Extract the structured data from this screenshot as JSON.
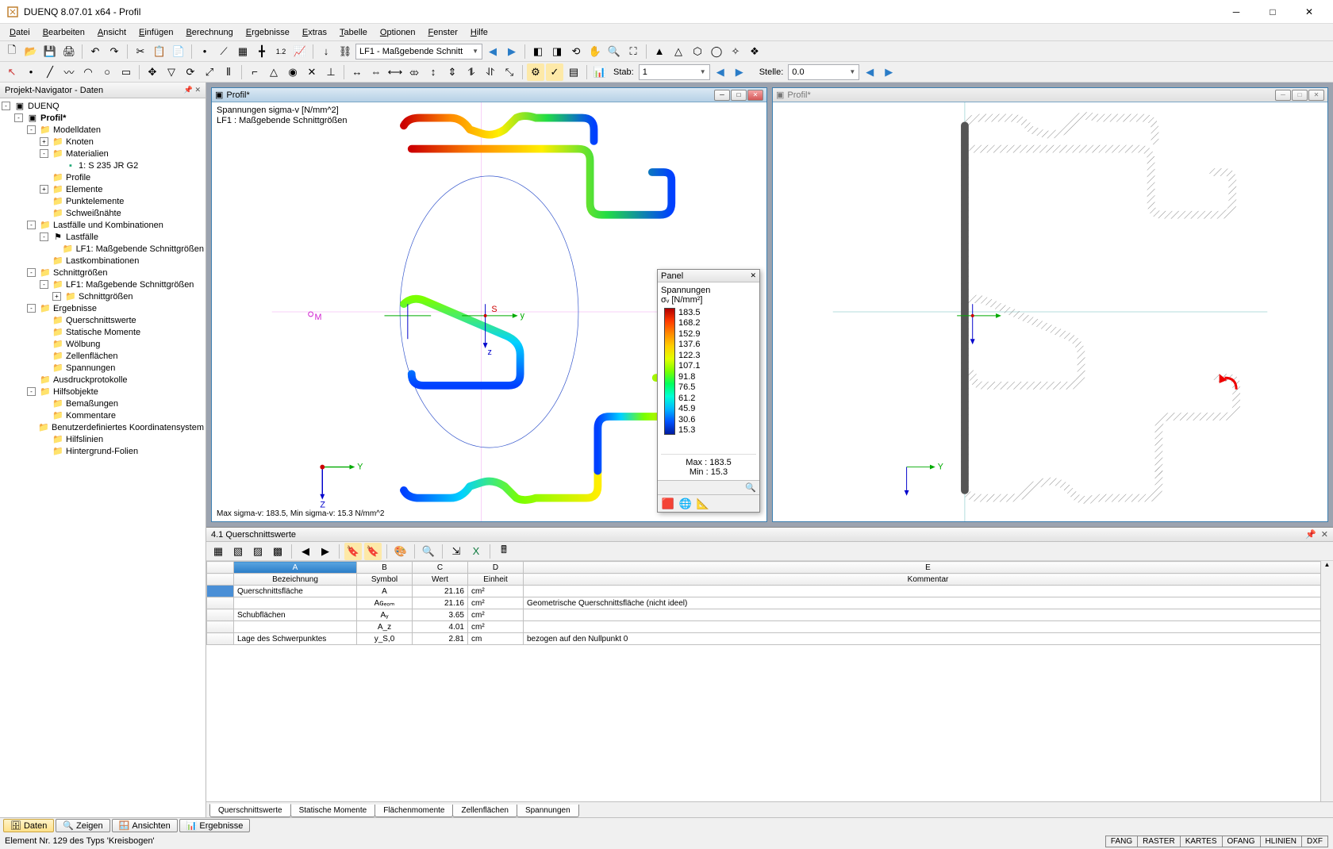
{
  "titlebar": {
    "text": "DUENQ 8.07.01 x64 - Profil"
  },
  "menus": [
    "Datei",
    "Bearbeiten",
    "Ansicht",
    "Einfügen",
    "Berechnung",
    "Ergebnisse",
    "Extras",
    "Tabelle",
    "Optionen",
    "Fenster",
    "Hilfe"
  ],
  "toolbar1": {
    "combo_lf": "LF1 - Maßgebende Schnitt"
  },
  "toolbar2": {
    "stab_label": "Stab:",
    "stab_value": "1",
    "stelle_label": "Stelle:",
    "stelle_value": "0.0"
  },
  "navigator": {
    "title": "Projekt-Navigator - Daten",
    "root": "DUENQ",
    "items": [
      {
        "d": 0,
        "t": "-",
        "i": "app",
        "l": "DUENQ",
        "b": false
      },
      {
        "d": 1,
        "t": "-",
        "i": "app",
        "l": "Profil*",
        "b": true
      },
      {
        "d": 2,
        "t": "-",
        "i": "f",
        "l": "Modelldaten"
      },
      {
        "d": 3,
        "t": "+",
        "i": "f",
        "l": "Knoten"
      },
      {
        "d": 3,
        "t": "-",
        "i": "f",
        "l": "Materialien"
      },
      {
        "d": 4,
        "t": "",
        "i": "m",
        "l": "1: S 235 JR G2"
      },
      {
        "d": 3,
        "t": "",
        "i": "f",
        "l": "Profile"
      },
      {
        "d": 3,
        "t": "+",
        "i": "f",
        "l": "Elemente"
      },
      {
        "d": 3,
        "t": "",
        "i": "f",
        "l": "Punktelemente"
      },
      {
        "d": 3,
        "t": "",
        "i": "f",
        "l": "Schweißnähte"
      },
      {
        "d": 2,
        "t": "-",
        "i": "f",
        "l": "Lastfälle und Kombinationen"
      },
      {
        "d": 3,
        "t": "-",
        "i": "lf",
        "l": "Lastfälle"
      },
      {
        "d": 4,
        "t": "",
        "i": "f",
        "l": "LF1: Maßgebende Schnittgrößen"
      },
      {
        "d": 3,
        "t": "",
        "i": "f",
        "l": "Lastkombinationen"
      },
      {
        "d": 2,
        "t": "-",
        "i": "f",
        "l": "Schnittgrößen"
      },
      {
        "d": 3,
        "t": "-",
        "i": "f",
        "l": "LF1: Maßgebende Schnittgrößen"
      },
      {
        "d": 4,
        "t": "+",
        "i": "f",
        "l": "Schnittgrößen"
      },
      {
        "d": 2,
        "t": "-",
        "i": "f",
        "l": "Ergebnisse"
      },
      {
        "d": 3,
        "t": "",
        "i": "f",
        "l": "Querschnittswerte"
      },
      {
        "d": 3,
        "t": "",
        "i": "f",
        "l": "Statische Momente"
      },
      {
        "d": 3,
        "t": "",
        "i": "f",
        "l": "Wölbung"
      },
      {
        "d": 3,
        "t": "",
        "i": "f",
        "l": "Zellenflächen"
      },
      {
        "d": 3,
        "t": "",
        "i": "f",
        "l": "Spannungen"
      },
      {
        "d": 2,
        "t": "",
        "i": "f",
        "l": "Ausdruckprotokolle"
      },
      {
        "d": 2,
        "t": "-",
        "i": "f",
        "l": "Hilfsobjekte"
      },
      {
        "d": 3,
        "t": "",
        "i": "f",
        "l": "Bemaßungen"
      },
      {
        "d": 3,
        "t": "",
        "i": "f",
        "l": "Kommentare"
      },
      {
        "d": 3,
        "t": "",
        "i": "f",
        "l": "Benutzerdefiniertes Koordinatensystem"
      },
      {
        "d": 3,
        "t": "",
        "i": "f",
        "l": "Hilfslinien"
      },
      {
        "d": 3,
        "t": "",
        "i": "f",
        "l": "Hintergrund-Folien"
      }
    ]
  },
  "view_left": {
    "title": "Profil*",
    "top_line1": "Spannungen sigma-v [N/mm^2]",
    "top_line2": "LF1 : Maßgebende Schnittgrößen",
    "bottom": "Max sigma-v: 183.5, Min sigma-v: 15.3 N/mm^2"
  },
  "view_right": {
    "title": "Profil*"
  },
  "panel": {
    "title": "Panel",
    "heading": "Spannungen",
    "unit": "σᵥ [N/mm²]",
    "scale": [
      "183.5",
      "168.2",
      "152.9",
      "137.6",
      "122.3",
      "107.1",
      "91.8",
      "76.5",
      "61.2",
      "45.9",
      "30.6",
      "15.3"
    ],
    "max_label": "Max  :",
    "max_value": "183.5",
    "min_label": "Min   :",
    "min_value": "15.3"
  },
  "table": {
    "title": "4.1 Querschnittswerte",
    "cols_letters": [
      "A",
      "B",
      "C",
      "D",
      "E"
    ],
    "cols_names": [
      "Bezeichnung",
      "Symbol",
      "Wert",
      "Einheit",
      "Kommentar"
    ],
    "rows": [
      {
        "a": "Querschnittsfläche",
        "b": "A",
        "c": "21.16",
        "d": "cm²",
        "e": ""
      },
      {
        "a": "",
        "b": "Aɢₑₒₘ",
        "c": "21.16",
        "d": "cm²",
        "e": "Geometrische Querschnittsfläche (nicht ideel)"
      },
      {
        "a": "Schubflächen",
        "b": "Aᵧ",
        "c": "3.65",
        "d": "cm²",
        "e": ""
      },
      {
        "a": "",
        "b": "A_z",
        "c": "4.01",
        "d": "cm²",
        "e": ""
      },
      {
        "a": "Lage des Schwerpunktes",
        "b": "y_S,0",
        "c": "2.81",
        "d": "cm",
        "e": "bezogen auf den Nullpunkt 0"
      }
    ],
    "tabs": [
      "Querschnittswerte",
      "Statische Momente",
      "Flächenmomente",
      "Zellenflächen",
      "Spannungen"
    ]
  },
  "bottom_tabs": [
    {
      "icon": "🗄",
      "label": "Daten",
      "active": true
    },
    {
      "icon": "🔍",
      "label": "Zeigen",
      "active": false
    },
    {
      "icon": "🪟",
      "label": "Ansichten",
      "active": false
    },
    {
      "icon": "📊",
      "label": "Ergebnisse",
      "active": false
    }
  ],
  "status": {
    "left": "Element Nr. 129 des Typs 'Kreisbogen'",
    "chips": [
      "FANG",
      "RASTER",
      "KARTES",
      "OFANG",
      "HLINIEN",
      "DXF"
    ]
  }
}
